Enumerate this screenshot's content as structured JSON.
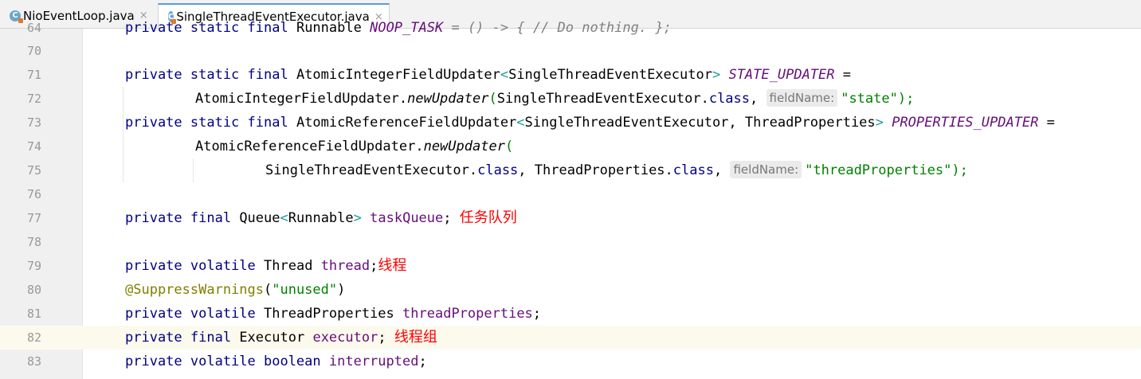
{
  "tabs": [
    {
      "name": "NioEventLoop.java",
      "active": false
    },
    {
      "name": "SingleThreadEventExecutor.java",
      "active": true
    }
  ],
  "tab_close_glyph": "×",
  "file_icon_letter": "C",
  "lines": [
    {
      "num": "64",
      "text": "    private static final Runnable NOOP_TASK = () -> { // Do nothing. };"
    },
    {
      "num": "70",
      "text": ""
    },
    {
      "num": "71",
      "text": "    private static final AtomicIntegerFieldUpdater<SingleThreadEventExecutor> STATE_UPDATER ="
    },
    {
      "num": "72",
      "text": "            AtomicIntegerFieldUpdater.newUpdater(SingleThreadEventExecutor.class, fieldName: \"state\");"
    },
    {
      "num": "73",
      "text": "    private static final AtomicReferenceFieldUpdater<SingleThreadEventExecutor, ThreadProperties> PROPERTIES_UPDATER ="
    },
    {
      "num": "74",
      "text": "            AtomicReferenceFieldUpdater.newUpdater("
    },
    {
      "num": "75",
      "text": "                    SingleThreadEventExecutor.class, ThreadProperties.class, fieldName: \"threadProperties\");"
    },
    {
      "num": "76",
      "text": ""
    },
    {
      "num": "77",
      "text": "    private final Queue<Runnable> taskQueue; 任务队列"
    },
    {
      "num": "78",
      "text": ""
    },
    {
      "num": "79",
      "text": "    private volatile Thread thread;线程"
    },
    {
      "num": "80",
      "text": "    @SuppressWarnings(\"unused\")"
    },
    {
      "num": "81",
      "text": "    private volatile ThreadProperties threadProperties;"
    },
    {
      "num": "82",
      "text": "    private final Executor executor; 线程组",
      "current": true
    },
    {
      "num": "83",
      "text": "    private volatile boolean interrupted;"
    }
  ],
  "tokens": {
    "l64": {
      "kw": "private static final",
      "type": "Runnable",
      "name": "NOOP_TASK",
      "rest": "= () -> { // Do nothing. };"
    },
    "l71": {
      "kw": "private static final",
      "type": "AtomicIntegerFieldUpdater",
      "lt": "<",
      "generic": "SingleThreadEventExecutor",
      "gt": ">",
      "name": "STATE_UPDATER",
      "eq": "="
    },
    "l72": {
      "cls": "AtomicIntegerFieldUpdater.",
      "method": "newUpdater",
      "open": "(",
      "arg": "SingleThreadEventExecutor.",
      "classkw": "class",
      "comma": ",",
      "hint": "fieldName:",
      "str": "\"state\"",
      "close": ");"
    },
    "l73": {
      "kw": "private static final",
      "type": "AtomicReferenceFieldUpdater",
      "lt": "<",
      "generic": "SingleThreadEventExecutor, ThreadProperties",
      "gt": ">",
      "name": "PROPERTIES_UPDATER",
      "eq": "="
    },
    "l74": {
      "cls": "AtomicReferenceFieldUpdater.",
      "method": "newUpdater",
      "open": "("
    },
    "l75": {
      "arg1": "SingleThreadEventExecutor.",
      "classkw1": "class",
      "sep": ", ",
      "arg2": "ThreadProperties.",
      "classkw2": "class",
      "comma": ",",
      "hint": "fieldName:",
      "str": "\"threadProperties\"",
      "close": ");"
    },
    "l77": {
      "kw": "private final",
      "type": "Queue",
      "lt": "<",
      "generic": "Runnable",
      "gt": ">",
      "name": "taskQueue",
      "semi": ";",
      "note": "任务队列"
    },
    "l79": {
      "kw": "private volatile",
      "type": "Thread",
      "name": "thread",
      "semi": ";",
      "note": "线程"
    },
    "l80": {
      "ann": "@SuppressWarnings",
      "open": "(",
      "str": "\"unused\"",
      "close": ")"
    },
    "l81": {
      "kw": "private volatile",
      "type": "ThreadProperties",
      "name": "threadProperties",
      "semi": ";"
    },
    "l82": {
      "kw": "private final",
      "type": "Executor",
      "name": "executor",
      "semi": ";",
      "note": "线程组"
    },
    "l83": {
      "kw": "private volatile boolean",
      "name": "interrupted",
      "semi": ";"
    }
  }
}
